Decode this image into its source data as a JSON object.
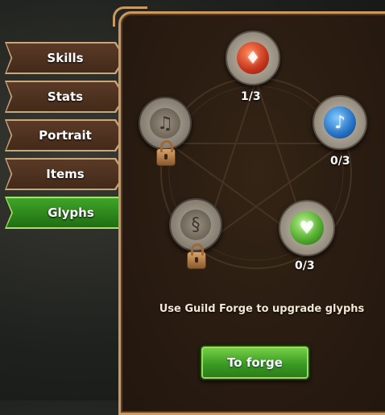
{
  "tabs": [
    {
      "label": "Skills",
      "active": false
    },
    {
      "label": "Stats",
      "active": false
    },
    {
      "label": "Portrait",
      "active": false
    },
    {
      "label": "Items",
      "active": false
    },
    {
      "label": "Glyphs",
      "active": true
    }
  ],
  "glyphs": {
    "fire": {
      "count": "1/3",
      "icon": "fire-glyph-icon",
      "color": "#d8482a"
    },
    "water": {
      "count": "0/3",
      "icon": "water-glyph-icon",
      "color": "#2f86d8"
    },
    "nature": {
      "count": "0/3",
      "icon": "nature-glyph-icon",
      "color": "#5cc43a"
    },
    "locked_left": {
      "icon": "locked-glyph-icon",
      "color": "#8a8070"
    },
    "locked_bottom": {
      "icon": "locked-glyph-icon",
      "color": "#8a8070"
    }
  },
  "info_text": "Use Guild Forge to upgrade glyphs",
  "forge_button": "To forge"
}
